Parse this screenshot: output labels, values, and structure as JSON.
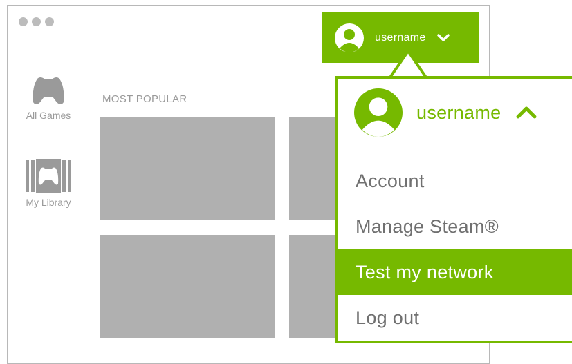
{
  "colors": {
    "accent": "#76b900",
    "tile": "#b0b0b0",
    "text_muted": "#9a9a9a",
    "menu_text": "#707070"
  },
  "header": {
    "username": "username"
  },
  "sidebar": {
    "items": [
      {
        "label": "All Games",
        "icon": "gamepad-icon"
      },
      {
        "label": "My Library",
        "icon": "library-gamepad-icon"
      }
    ]
  },
  "main": {
    "section_title": "MOST POPULAR"
  },
  "dropdown": {
    "username": "username",
    "items": [
      {
        "label": "Account"
      },
      {
        "label": "Manage Steam®"
      },
      {
        "label": "Test my network",
        "active": true
      },
      {
        "label": "Log out"
      }
    ]
  }
}
